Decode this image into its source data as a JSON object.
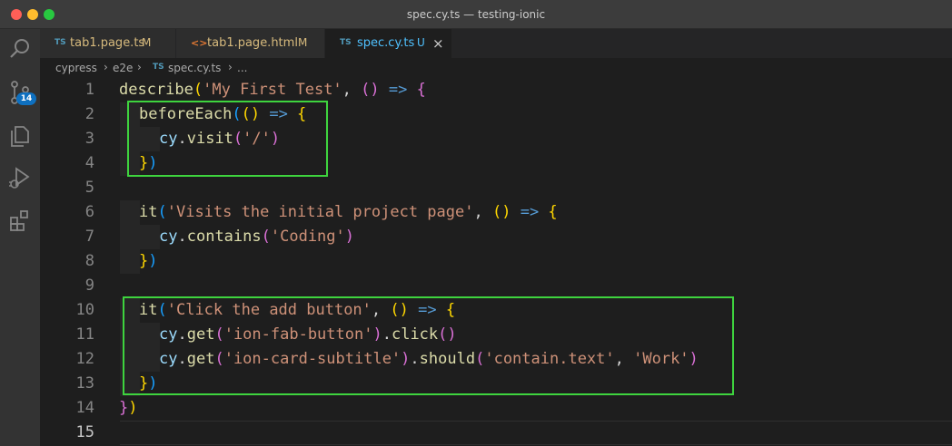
{
  "window": {
    "title": "spec.cy.ts — testing-ionic"
  },
  "activity": {
    "scm_badge": "14"
  },
  "tabs": [
    {
      "icon": "TS",
      "label": "tab1.page.ts",
      "status": "M"
    },
    {
      "icon": "<>",
      "label": "tab1.page.html",
      "status": "M"
    },
    {
      "icon": "TS",
      "label": "spec.cy.ts",
      "status": "U",
      "close": "×"
    }
  ],
  "breadcrumb": {
    "parts": [
      "cypress",
      "e2e",
      "spec.cy.ts",
      "..."
    ],
    "file_icon": "TS"
  },
  "editor": {
    "line_numbers": [
      "1",
      "2",
      "3",
      "4",
      "5",
      "6",
      "7",
      "8",
      "9",
      "10",
      "11",
      "12",
      "13",
      "14",
      "15"
    ],
    "lines": {
      "l1": {
        "fn": "describe",
        "o": "(",
        "s": "'My First Test'",
        "c": ", ",
        "p": "()",
        "a": " =>",
        "b": " {"
      },
      "l2": {
        "fn": "beforeEach",
        "o": "(",
        "p": "()",
        "a": " =>",
        "b": " {"
      },
      "l3": {
        "v": "cy",
        "d": ".",
        "fn": "visit",
        "o": "(",
        "s": "'/'",
        "cl": ")"
      },
      "l4": {
        "b": "}",
        "cl": ")"
      },
      "l6": {
        "fn": "it",
        "o": "(",
        "s": "'Visits the initial project page'",
        "c": ", ",
        "p": "()",
        "a": " =>",
        "b": " {"
      },
      "l7": {
        "v": "cy",
        "d": ".",
        "fn": "contains",
        "o": "(",
        "s": "'Coding'",
        "cl": ")"
      },
      "l8": {
        "b": "}",
        "cl": ")"
      },
      "l10": {
        "fn": "it",
        "o": "(",
        "s": "'Click the add button'",
        "c": ", ",
        "p": "()",
        "a": " =>",
        "b": " {"
      },
      "l11": {
        "v": "cy",
        "d": ".",
        "fn": "get",
        "o": "(",
        "s": "'ion-fab-button'",
        "cl": ")",
        "d2": ".",
        "fn2": "click",
        "p2": "()"
      },
      "l12": {
        "v": "cy",
        "d": ".",
        "fn": "get",
        "o": "(",
        "s": "'ion-card-subtitle'",
        "cl": ")",
        "d2": ".",
        "fn2": "should",
        "o2": "(",
        "s2": "'contain.text'",
        "c2": ", ",
        "s3": "'Work'",
        "cl2": ")"
      },
      "l13": {
        "b": "}",
        "cl": ")"
      },
      "l14": {
        "b": "}",
        "cl": ")"
      }
    }
  },
  "colors": {
    "highlight_box": "#3ed43e",
    "function": "#dcdcaa",
    "string": "#ce9178",
    "variable": "#9cdcfe",
    "arrow": "#569cd6",
    "bracket_1": "#ffd700",
    "bracket_2": "#da70d6",
    "bracket_3": "#179fff"
  },
  "icons": [
    "search-icon",
    "source-control-icon",
    "explorer-icon",
    "run-debug-icon",
    "extensions-icon"
  ]
}
